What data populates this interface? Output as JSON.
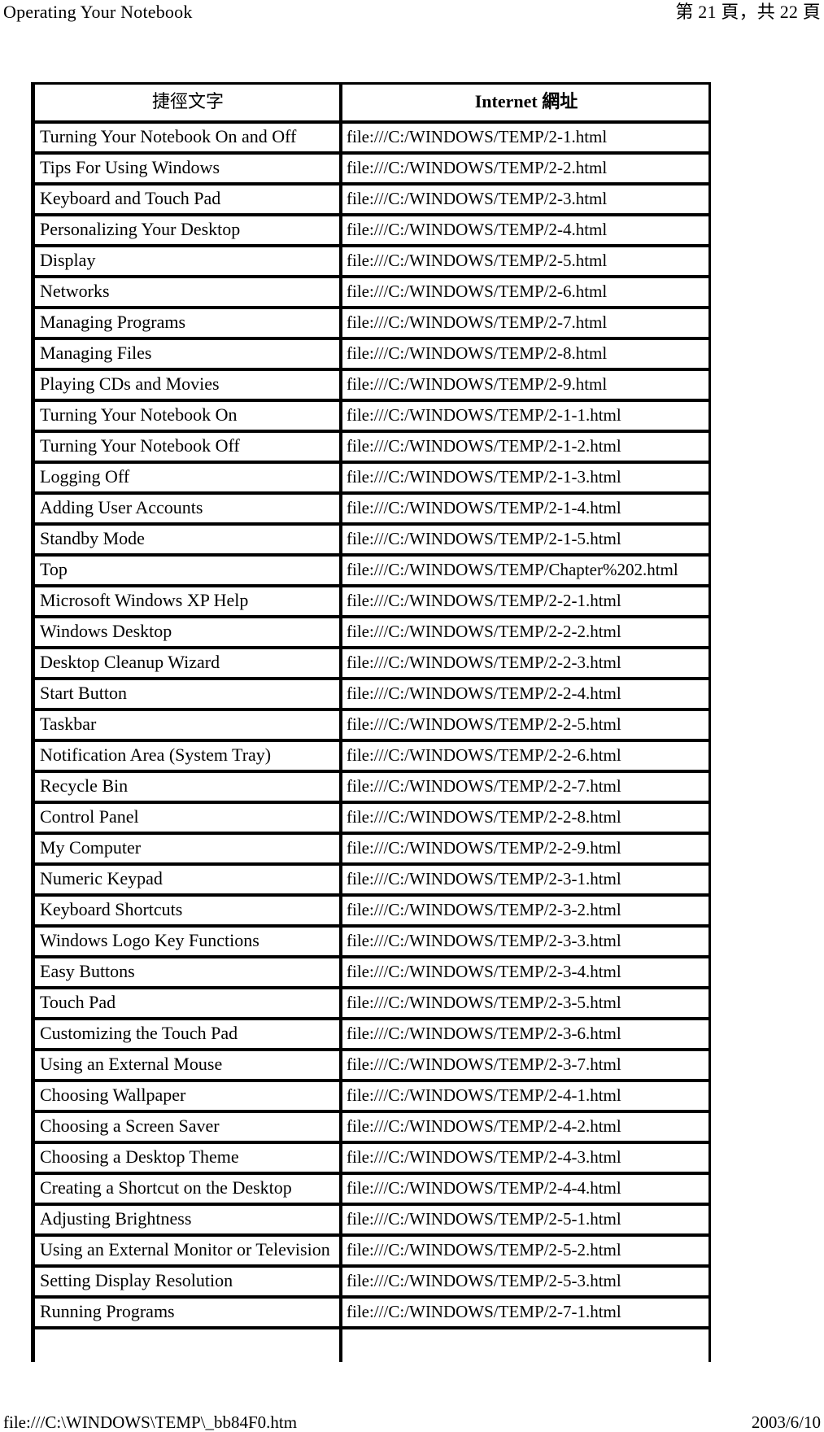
{
  "header": {
    "document_title": "Operating Your Notebook",
    "page_indicator": "第 21 頁，共 22 頁"
  },
  "table": {
    "columns": [
      {
        "key": "shortcut_text",
        "label": "捷徑文字"
      },
      {
        "key": "internet_address",
        "label": "Internet 網址"
      }
    ],
    "rows": [
      {
        "shortcut_text": "Turning Your Notebook On and Off",
        "internet_address": "file:///C:/WINDOWS/TEMP/2-1.html"
      },
      {
        "shortcut_text": "Tips For Using Windows",
        "internet_address": "file:///C:/WINDOWS/TEMP/2-2.html"
      },
      {
        "shortcut_text": "Keyboard and Touch Pad",
        "internet_address": "file:///C:/WINDOWS/TEMP/2-3.html"
      },
      {
        "shortcut_text": "Personalizing Your Desktop",
        "internet_address": "file:///C:/WINDOWS/TEMP/2-4.html"
      },
      {
        "shortcut_text": "Display",
        "internet_address": "file:///C:/WINDOWS/TEMP/2-5.html"
      },
      {
        "shortcut_text": "Networks",
        "internet_address": "file:///C:/WINDOWS/TEMP/2-6.html"
      },
      {
        "shortcut_text": "Managing Programs",
        "internet_address": "file:///C:/WINDOWS/TEMP/2-7.html"
      },
      {
        "shortcut_text": "Managing Files",
        "internet_address": "file:///C:/WINDOWS/TEMP/2-8.html"
      },
      {
        "shortcut_text": "Playing CDs and Movies",
        "internet_address": "file:///C:/WINDOWS/TEMP/2-9.html"
      },
      {
        "shortcut_text": "Turning Your Notebook On",
        "internet_address": "file:///C:/WINDOWS/TEMP/2-1-1.html"
      },
      {
        "shortcut_text": "Turning Your Notebook Off",
        "internet_address": "file:///C:/WINDOWS/TEMP/2-1-2.html"
      },
      {
        "shortcut_text": "Logging Off",
        "internet_address": "file:///C:/WINDOWS/TEMP/2-1-3.html"
      },
      {
        "shortcut_text": "Adding User Accounts",
        "internet_address": "file:///C:/WINDOWS/TEMP/2-1-4.html"
      },
      {
        "shortcut_text": "Standby Mode",
        "internet_address": "file:///C:/WINDOWS/TEMP/2-1-5.html"
      },
      {
        "shortcut_text": "Top",
        "internet_address": "file:///C:/WINDOWS/TEMP/Chapter%202.html"
      },
      {
        "shortcut_text": "Microsoft Windows XP Help",
        "internet_address": "file:///C:/WINDOWS/TEMP/2-2-1.html"
      },
      {
        "shortcut_text": "Windows Desktop",
        "internet_address": "file:///C:/WINDOWS/TEMP/2-2-2.html"
      },
      {
        "shortcut_text": "Desktop Cleanup Wizard",
        "internet_address": "file:///C:/WINDOWS/TEMP/2-2-3.html"
      },
      {
        "shortcut_text": "Start Button",
        "internet_address": "file:///C:/WINDOWS/TEMP/2-2-4.html"
      },
      {
        "shortcut_text": "Taskbar",
        "internet_address": "file:///C:/WINDOWS/TEMP/2-2-5.html"
      },
      {
        "shortcut_text": "Notification Area (System Tray)",
        "internet_address": "file:///C:/WINDOWS/TEMP/2-2-6.html"
      },
      {
        "shortcut_text": "Recycle Bin",
        "internet_address": "file:///C:/WINDOWS/TEMP/2-2-7.html"
      },
      {
        "shortcut_text": "Control Panel",
        "internet_address": "file:///C:/WINDOWS/TEMP/2-2-8.html"
      },
      {
        "shortcut_text": "My Computer",
        "internet_address": "file:///C:/WINDOWS/TEMP/2-2-9.html"
      },
      {
        "shortcut_text": "Numeric Keypad",
        "internet_address": "file:///C:/WINDOWS/TEMP/2-3-1.html"
      },
      {
        "shortcut_text": "Keyboard Shortcuts",
        "internet_address": "file:///C:/WINDOWS/TEMP/2-3-2.html"
      },
      {
        "shortcut_text": "Windows Logo Key Functions",
        "internet_address": "file:///C:/WINDOWS/TEMP/2-3-3.html"
      },
      {
        "shortcut_text": "Easy Buttons",
        "internet_address": "file:///C:/WINDOWS/TEMP/2-3-4.html"
      },
      {
        "shortcut_text": "Touch Pad",
        "internet_address": "file:///C:/WINDOWS/TEMP/2-3-5.html"
      },
      {
        "shortcut_text": "Customizing the Touch Pad",
        "internet_address": "file:///C:/WINDOWS/TEMP/2-3-6.html"
      },
      {
        "shortcut_text": "Using an External Mouse",
        "internet_address": "file:///C:/WINDOWS/TEMP/2-3-7.html"
      },
      {
        "shortcut_text": "Choosing Wallpaper",
        "internet_address": "file:///C:/WINDOWS/TEMP/2-4-1.html"
      },
      {
        "shortcut_text": "Choosing a Screen Saver",
        "internet_address": "file:///C:/WINDOWS/TEMP/2-4-2.html"
      },
      {
        "shortcut_text": "Choosing a Desktop Theme",
        "internet_address": "file:///C:/WINDOWS/TEMP/2-4-3.html"
      },
      {
        "shortcut_text": "Creating a Shortcut on the Desktop",
        "internet_address": "file:///C:/WINDOWS/TEMP/2-4-4.html"
      },
      {
        "shortcut_text": "Adjusting Brightness",
        "internet_address": "file:///C:/WINDOWS/TEMP/2-5-1.html"
      },
      {
        "shortcut_text": "Using an External Monitor or Television",
        "internet_address": "file:///C:/WINDOWS/TEMP/2-5-2.html"
      },
      {
        "shortcut_text": "Setting Display Resolution",
        "internet_address": "file:///C:/WINDOWS/TEMP/2-5-3.html"
      },
      {
        "shortcut_text": "Running Programs",
        "internet_address": "file:///C:/WINDOWS/TEMP/2-7-1.html"
      },
      {
        "shortcut_text": "",
        "internet_address": ""
      }
    ]
  },
  "footer": {
    "source_path": "file:///C:\\WINDOWS\\TEMP\\_bb84F0.htm",
    "print_date": "2003/6/10"
  }
}
